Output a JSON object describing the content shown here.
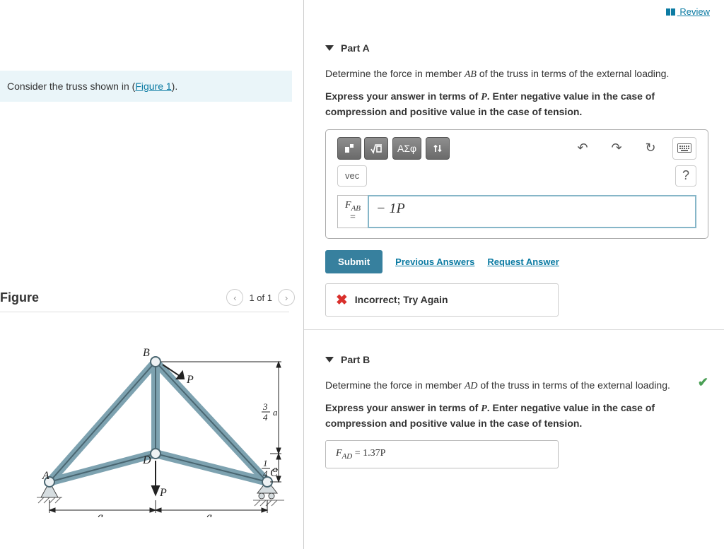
{
  "left": {
    "prompt_prefix": "Consider the truss shown in (",
    "prompt_linktext": "Figure 1",
    "prompt_suffix": ").",
    "figure_title": "Figure",
    "figure_count": "1 of 1",
    "diagram": {
      "point_A": "A",
      "point_B": "B",
      "point_C": "C",
      "point_D": "D",
      "load_P_top": "P",
      "load_P_bottom": "P",
      "span_left": "a",
      "span_right": "a",
      "height_upper": "¾ a",
      "height_lower": "¼ a"
    }
  },
  "right": {
    "review": "Review",
    "partA": {
      "title": "Part A",
      "question_pre": "Determine the force in member ",
      "question_var": "AB",
      "question_post": " of the truss in terms of the external loading.",
      "instruction_a": "Express your answer in terms of ",
      "instruction_var": "P",
      "instruction_b": ". Enter negative value in the case of compression and positive value in the case of tension.",
      "toolbar": {
        "greek": "ΑΣφ",
        "vec": "vec",
        "help": "?"
      },
      "input_var": "F",
      "input_sub": "AB",
      "input_eq": "=",
      "input_value": "− 1P",
      "submit": "Submit",
      "prev": "Previous Answers",
      "request": "Request Answer",
      "feedback": "Incorrect; Try Again"
    },
    "partB": {
      "title": "Part B",
      "question_pre": "Determine the force in member ",
      "question_var": "AD",
      "question_post": " of the truss in terms of the external loading.",
      "instruction_a": "Express your answer in terms of ",
      "instruction_var": "P",
      "instruction_b": ". Enter negative value in the case of compression and positive value in the case of tension.",
      "answer_var": "F",
      "answer_sub": "AD",
      "answer_eq": " = ",
      "answer_value": "1.37P"
    }
  }
}
